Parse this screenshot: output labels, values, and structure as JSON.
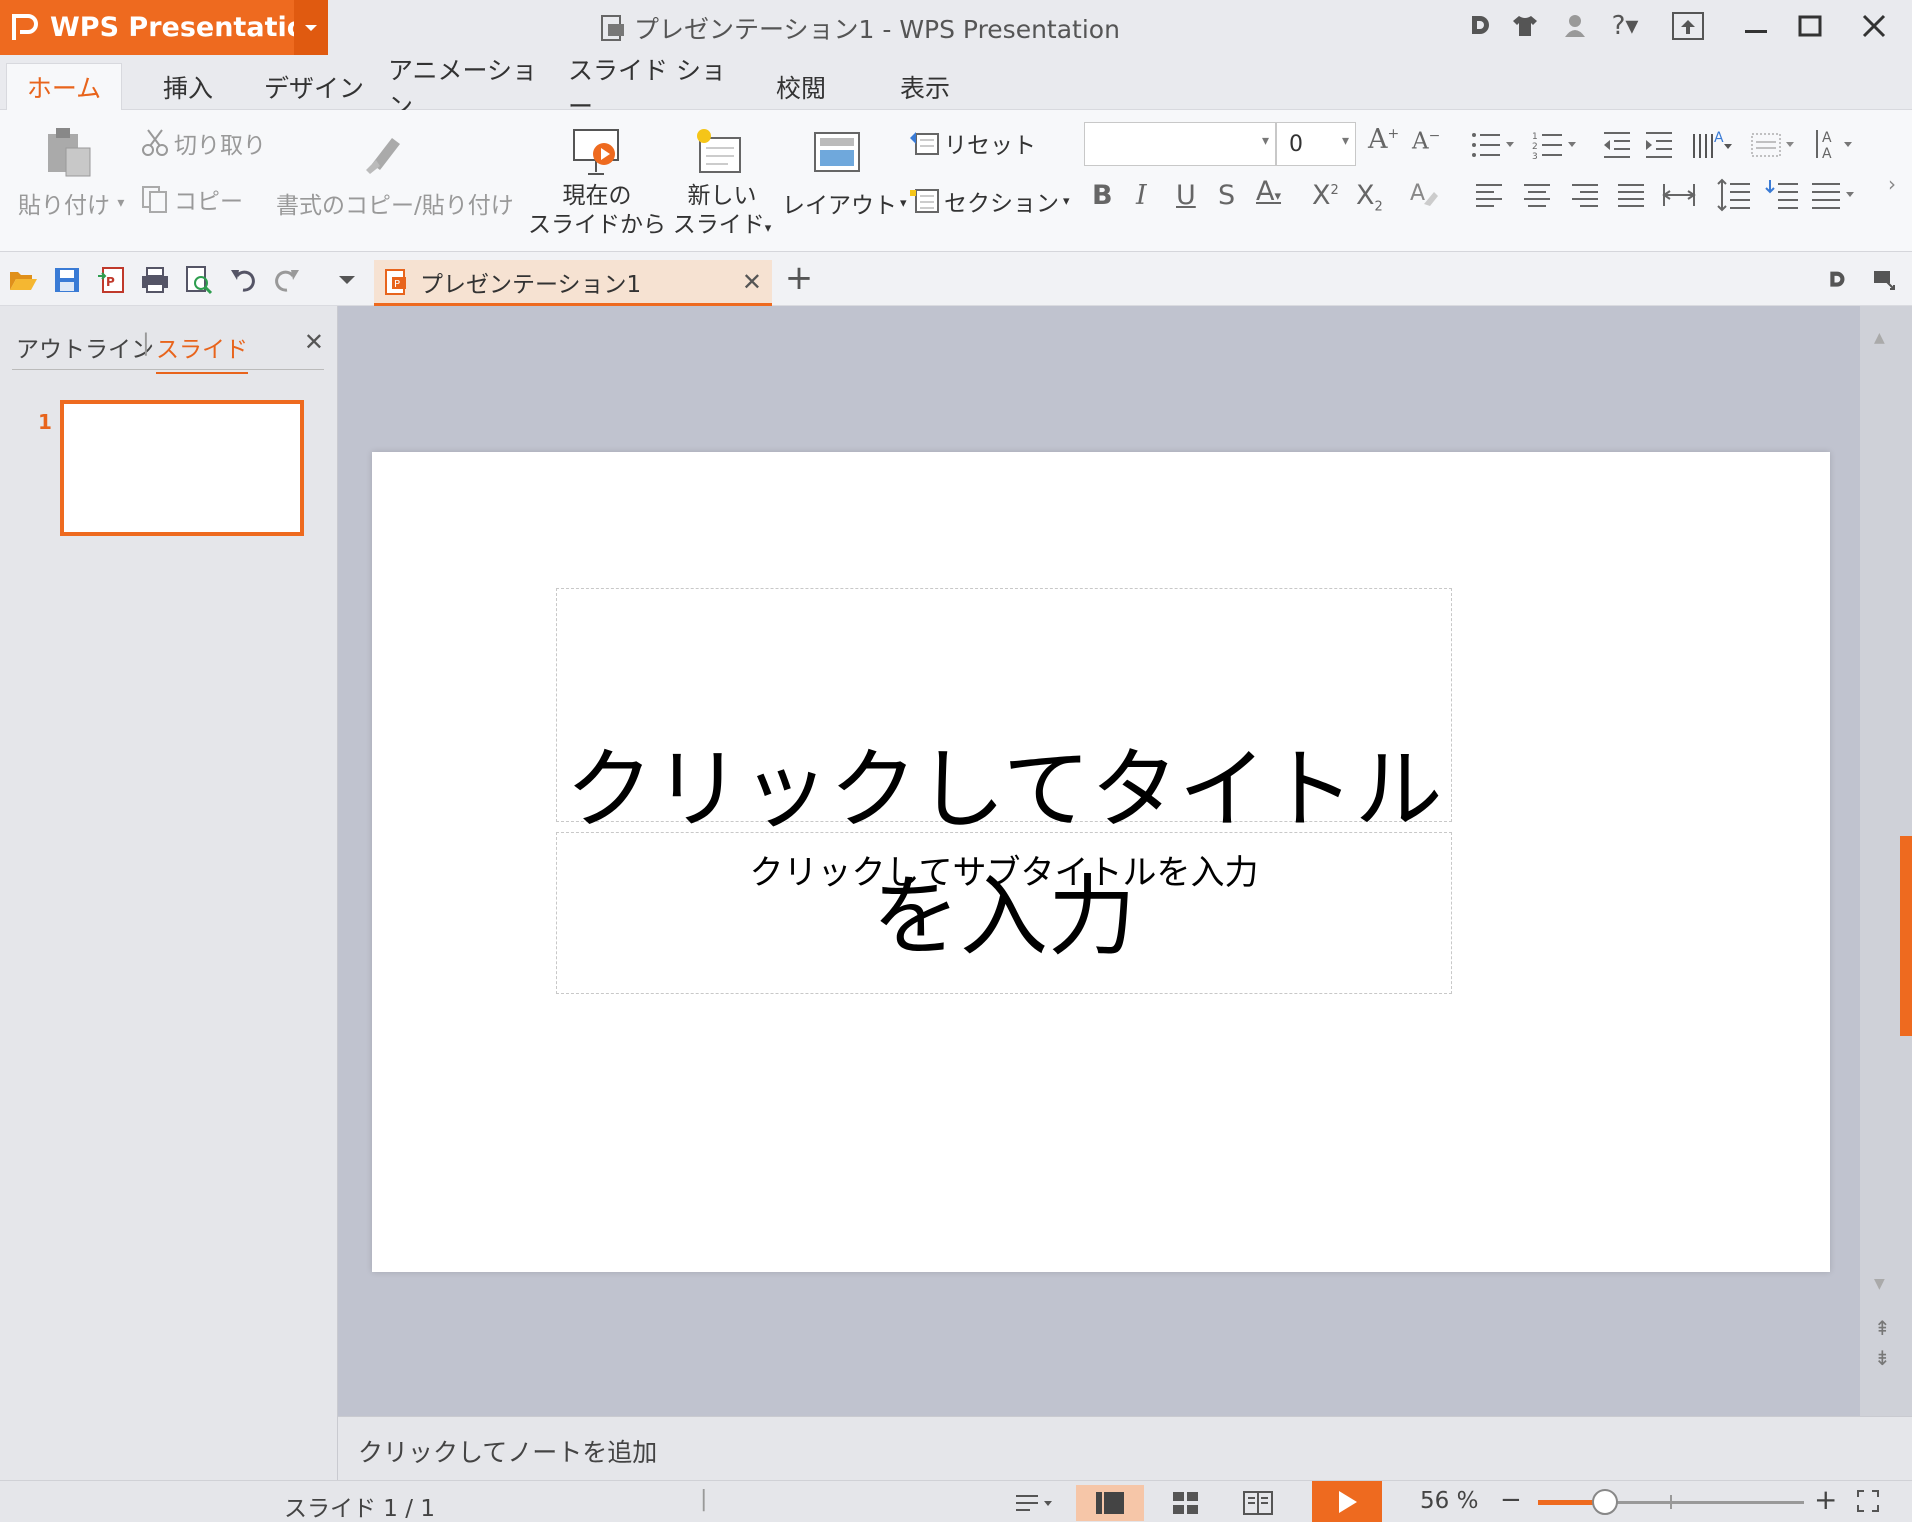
{
  "app": {
    "name": "WPS Presentation",
    "title": "プレゼンテーション1 - WPS Presentation"
  },
  "tabs": [
    "ホーム",
    "挿入",
    "デザイン",
    "アニメーション",
    "スライド ショー",
    "校閲",
    "表示"
  ],
  "ribbon": {
    "paste": "貼り付け",
    "cut": "切り取り",
    "copy": "コピー",
    "format_painter": "書式のコピー/貼り付け",
    "from_current_line1": "現在の",
    "from_current_line2": "スライドから",
    "new_slide_line1": "新しい",
    "new_slide_line2": "スライド",
    "layout": "レイアウト",
    "reset": "リセット",
    "section": "セクション",
    "font_size": "0"
  },
  "document_tab": {
    "name": "プレゼンテーション1"
  },
  "left_panel": {
    "outline_tab": "アウトライン",
    "slides_tab": "スライド",
    "slide_number": "1"
  },
  "slide": {
    "title_placeholder": "クリックしてタイトルを入力",
    "subtitle_placeholder": "クリックしてサブタイトルを入力"
  },
  "notes_placeholder": "クリックしてノートを追加",
  "status": {
    "slide_indicator": "スライド 1 / 1",
    "zoom": "56 %",
    "zoom_fraction": 0.25
  },
  "colors": {
    "accent": "#ee6a1f"
  }
}
